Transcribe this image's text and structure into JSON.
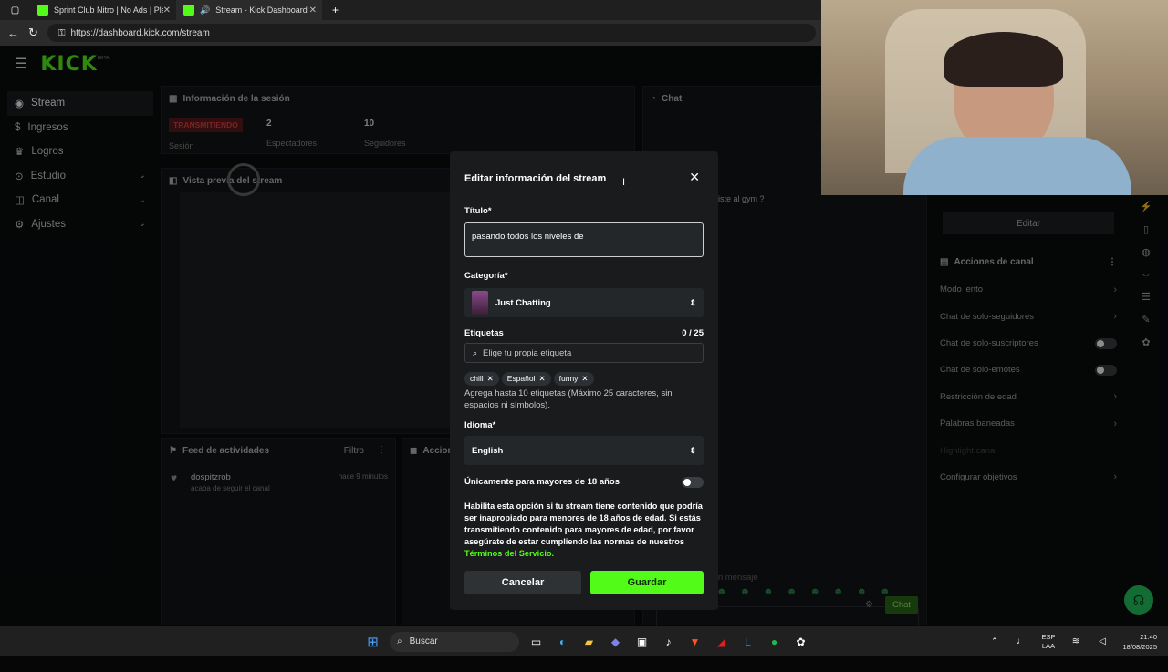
{
  "browser": {
    "tabs": [
      {
        "title": "Sprint Club Nitro | No Ads | Play"
      },
      {
        "title": "Stream - Kick Dashboard"
      }
    ],
    "url": "https://dashboard.kick.com/stream"
  },
  "brand": {
    "logo": "KICK",
    "beta": "BETA"
  },
  "sidebar": {
    "items": [
      {
        "label": "Stream",
        "icon": "stream-icon"
      },
      {
        "label": "Ingresos",
        "icon": "dollar-icon"
      },
      {
        "label": "Logros",
        "icon": "trophy-icon"
      },
      {
        "label": "Estudio",
        "icon": "studio-icon"
      },
      {
        "label": "Canal",
        "icon": "channel-icon"
      },
      {
        "label": "Ajustes",
        "icon": "gear-icon"
      }
    ]
  },
  "session": {
    "title": "Información de la sesión",
    "live_badge": "TRANSMITIENDO",
    "session_label": "Sesión",
    "viewers": "2",
    "viewers_label": "Espectadores",
    "followers": "10",
    "followers_label": "Seguidores"
  },
  "preview": {
    "title": "Vista previa del stream"
  },
  "feed": {
    "title": "Feed de actividades",
    "filter": "Filtro",
    "actions_title": "Accion",
    "entry": {
      "user": "dospitzrob",
      "text": "acaba de seguir el canal",
      "time": "hace 9 minutos"
    }
  },
  "chat": {
    "title": "Chat",
    "message_snippet": "iste al gym ?",
    "input_placeholder": "Enviar un mensaje",
    "send": "Chat"
  },
  "right": {
    "edit": "Editar",
    "actions_title": "Acciones de canal",
    "items": [
      {
        "label": "Modo lento",
        "type": "arrow"
      },
      {
        "label": "Chat de solo-seguidores",
        "type": "arrow"
      },
      {
        "label": "Chat de solo-suscriptores",
        "type": "toggle"
      },
      {
        "label": "Chat de solo-emotes",
        "type": "toggle"
      },
      {
        "label": "Restricción de edad",
        "type": "arrow"
      },
      {
        "label": "Palabras baneadas",
        "type": "arrow"
      },
      {
        "label": "Highlight canal",
        "type": "none"
      },
      {
        "label": "Configurar objetivos",
        "type": "arrow"
      }
    ]
  },
  "modal": {
    "title": "Editar información del stream",
    "title_label": "Título*",
    "title_value": "pasando todos los niveles de",
    "category_label": "Categoría*",
    "category_value": "Just Chatting",
    "tags_label": "Etiquetas",
    "tags_count": "0 / 25",
    "tags_placeholder": "Elige tu propia etiqueta",
    "tags": [
      "chill",
      "Español",
      "funny"
    ],
    "tags_help": "Agrega hasta 10 etiquetas (Máximo 25 caracteres, sin espacios ni símbolos).",
    "language_label": "Idioma*",
    "language_value": "English",
    "adult_label": "Únicamente para mayores de 18 años",
    "adult_help": "Habilita esta opción si tu stream tiene contenido que podría ser inapropiado para menores de 18 años de edad. Si estás transmitiendo contenido para mayores de edad, por favor asegúrate de estar cumpliendo las normas de nuestros",
    "terms_link": "Términos del Servicio.",
    "cancel": "Cancelar",
    "save": "Guardar"
  },
  "taskbar": {
    "search": "Buscar",
    "lang_top": "ESP",
    "lang_bottom": "LAA",
    "time": "21:40",
    "date": "18/08/2025"
  },
  "colors": {
    "accent": "#53fc18",
    "live": "#e1403f"
  }
}
